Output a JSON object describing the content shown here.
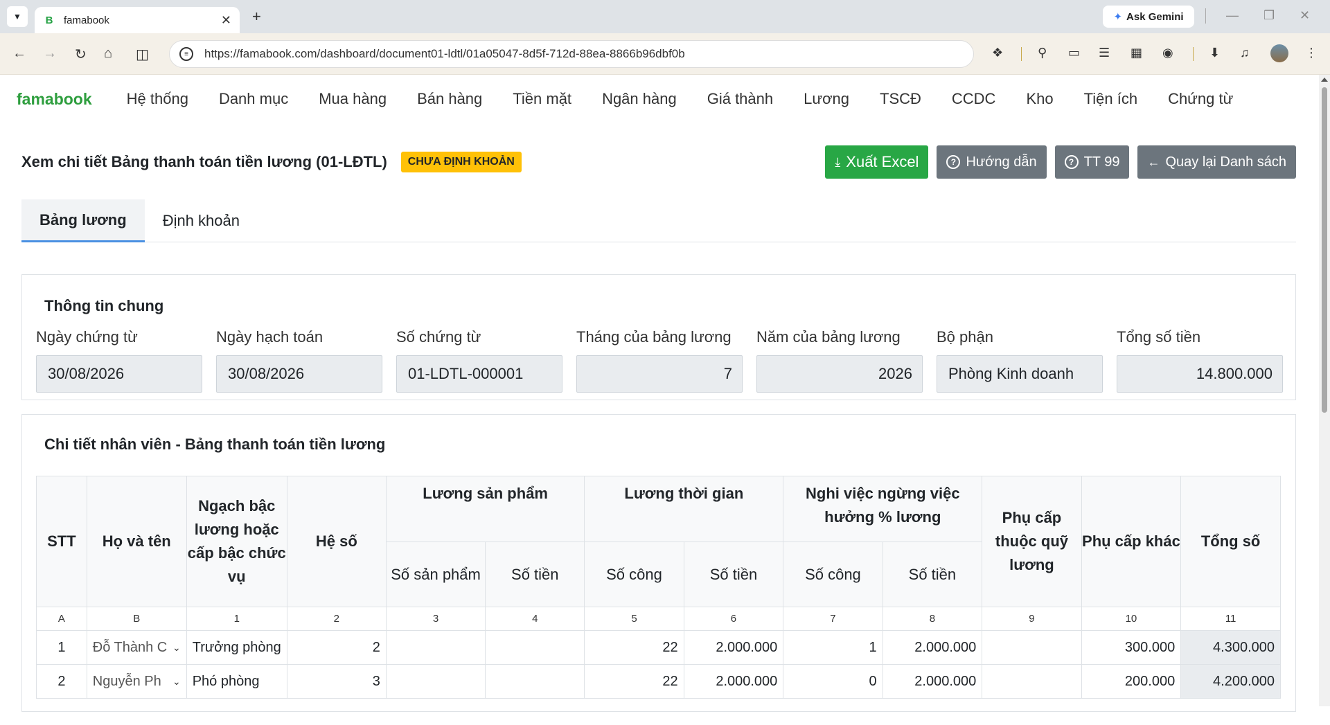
{
  "browser": {
    "tab_title": "famabook",
    "url": "https://famabook.com/dashboard/document01-ldtl/01a05047-8d5f-712d-88ea-8866b96dbf0b",
    "ask_gemini": "Ask Gemini"
  },
  "app": {
    "brand": "famabook",
    "menu": [
      "Hệ thống",
      "Danh mục",
      "Mua hàng",
      "Bán hàng",
      "Tiền mặt",
      "Ngân hàng",
      "Giá thành",
      "Lương",
      "TSCĐ",
      "CCDC",
      "Kho",
      "Tiện ích",
      "Chứng từ"
    ]
  },
  "header": {
    "title": "Xem chi tiết Bảng thanh toán tiền lương (01-LĐTL)",
    "status_badge": "CHƯA ĐỊNH KHOẢN",
    "export_label": "Xuất Excel",
    "guide_label": "Hướng dẫn",
    "tt_label": "TT 99",
    "back_label": "Quay lại Danh sách"
  },
  "tabs": [
    "Bảng lương",
    "Định khoản"
  ],
  "info": {
    "title": "Thông tin chung",
    "fields": [
      {
        "label": "Ngày chứng từ",
        "value": "30/08/2026"
      },
      {
        "label": "Ngày hạch toán",
        "value": "30/08/2026"
      },
      {
        "label": "Số chứng từ",
        "value": "01-LDTL-000001"
      },
      {
        "label": "Tháng của bảng lương",
        "value": "7"
      },
      {
        "label": "Năm của bảng lương",
        "value": "2026"
      },
      {
        "label": "Bộ phận",
        "value": "Phòng Kinh doanh"
      },
      {
        "label": "Tổng số tiền",
        "value": "14.800.000"
      }
    ]
  },
  "detail": {
    "title": "Chi tiết nhân viên - Bảng thanh toán tiền lương",
    "headers": {
      "stt": "STT",
      "name": "Họ và tên",
      "grade": "Ngạch bậc lương hoặc cấp bậc chức vụ",
      "coef": "Hệ số",
      "product_salary": "Lương sản phẩm",
      "time_salary": "Lương thời gian",
      "leave": "Nghi việc ngừng việc hưởng % lương",
      "allowance_fund": "Phụ cấp thuộc quỹ lương",
      "allowance_other": "Phụ cấp khác",
      "total": "Tổng số",
      "sub_product_qty": "Số sản phẩm",
      "sub_amount": "Số tiền",
      "sub_days": "Số công"
    },
    "index_row": [
      "A",
      "B",
      "1",
      "2",
      "3",
      "4",
      "5",
      "6",
      "7",
      "8",
      "9",
      "10",
      "11"
    ],
    "rows": [
      {
        "stt": "1",
        "name": "Đỗ Thành C",
        "grade": "Trưởng phòng",
        "coef": "2",
        "prod_qty": "",
        "prod_amt": "",
        "days": "22",
        "time_amt": "2.000.000",
        "leave_days": "1",
        "leave_amt": "2.000.000",
        "allow_fund": "",
        "allow_other": "300.000",
        "total": "4.300.000"
      },
      {
        "stt": "2",
        "name": "Nguyễn Ph",
        "grade": "Phó phòng",
        "coef": "3",
        "prod_qty": "",
        "prod_amt": "",
        "days": "22",
        "time_amt": "2.000.000",
        "leave_days": "0",
        "leave_amt": "2.000.000",
        "allow_fund": "",
        "allow_other": "200.000",
        "total": "4.200.000"
      }
    ]
  }
}
